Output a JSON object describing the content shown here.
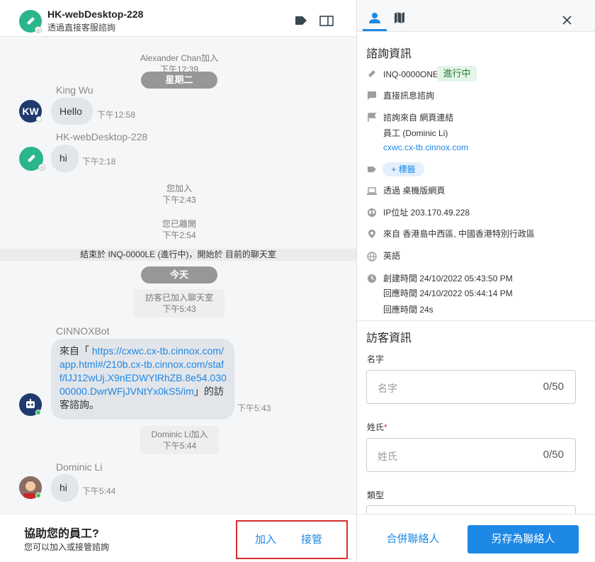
{
  "header": {
    "title": "HK-webDesktop-228",
    "subtitle": "透過直接客服諮詢"
  },
  "messages": {
    "alex_join": "Alexander Chan加入",
    "alex_time": "下午12:39",
    "day_tuesday": "星期二",
    "kingwu_name": "King Wu",
    "kingwu_initials": "KW",
    "kingwu_text": "Hello",
    "kingwu_time": "下午12:58",
    "hk_name": "HK-webDesktop-228",
    "hk_text": "hi",
    "hk_time": "下午2:18",
    "you_join": "您加入",
    "you_join_time": "下午2:43",
    "you_left": "您已離開",
    "you_left_time": "下午2:54",
    "ended_banner": "結束於 INQ-0000LE (進行中)，開始於 目前的聊天室",
    "day_today": "今天",
    "visitor_join": "訪客已加入聊天室",
    "visitor_join_time": "下午5:43",
    "bot_name": "CINNOXBot",
    "bot_text_prefix": "來自「 ",
    "bot_link": "https://cxwc.cx-tb.cinnox.com/app.html#/210b.cx-tb.cinnox.com/staff/lJJ12wUj.X9nEDWYlRhZB.8e54.03000000.DwrWFjJVNtYx0kS5/im",
    "bot_text_suffix": "」的訪客諮詢。",
    "bot_time": "下午5:43",
    "dominic_join": "Dominic Li加入",
    "dominic_join_time": "下午5:44",
    "dominic_name": "Dominic Li",
    "dominic_text": "hi",
    "dominic_time": "下午5:44"
  },
  "assist": {
    "title": "協助您的員工?",
    "subtitle": "您可以加入或接管諮詢",
    "join_label": "加入",
    "takeover_label": "接管"
  },
  "info": {
    "section_title": "諮詢資訊",
    "inquiry_id": "INQ-0000ONE",
    "status_badge": "進行中",
    "channel": "直接訊息諮詢",
    "source": "諮詢來自 網頁連結",
    "staff": "員工 (Dominic Li)",
    "source_link": "cxwc.cx-tb.cinnox.com",
    "tag_button": "+ 標籤",
    "via": "透過 桌機版網頁",
    "ip": "IP位址 203.170.49.228",
    "location": "來自 香港島中西區, 中國香港特別行政區",
    "language": "英語",
    "created": "創建時間 24/10/2022 05:43:50 PM",
    "responded": "回應時間 24/10/2022 05:44:14 PM",
    "response_duration": "回應時間 24s"
  },
  "visitor": {
    "section_title": "訪客資訊",
    "first_name_label": "名字",
    "first_name_placeholder": "名字",
    "first_name_count": "0/50",
    "last_name_label": "姓氏",
    "last_name_required": "*",
    "last_name_placeholder": "姓氏",
    "last_name_count": "0/50",
    "type_label": "類型"
  },
  "footer": {
    "merge_label": "合併聯絡人",
    "save_label": "另存為聯絡人"
  },
  "colors": {
    "brand_green": "#2bb58c",
    "accent_blue": "#1e88e5",
    "primary_button": "#1e88e5",
    "status_green_bg": "#e3f5e8",
    "highlight_red": "#d32f2f"
  }
}
